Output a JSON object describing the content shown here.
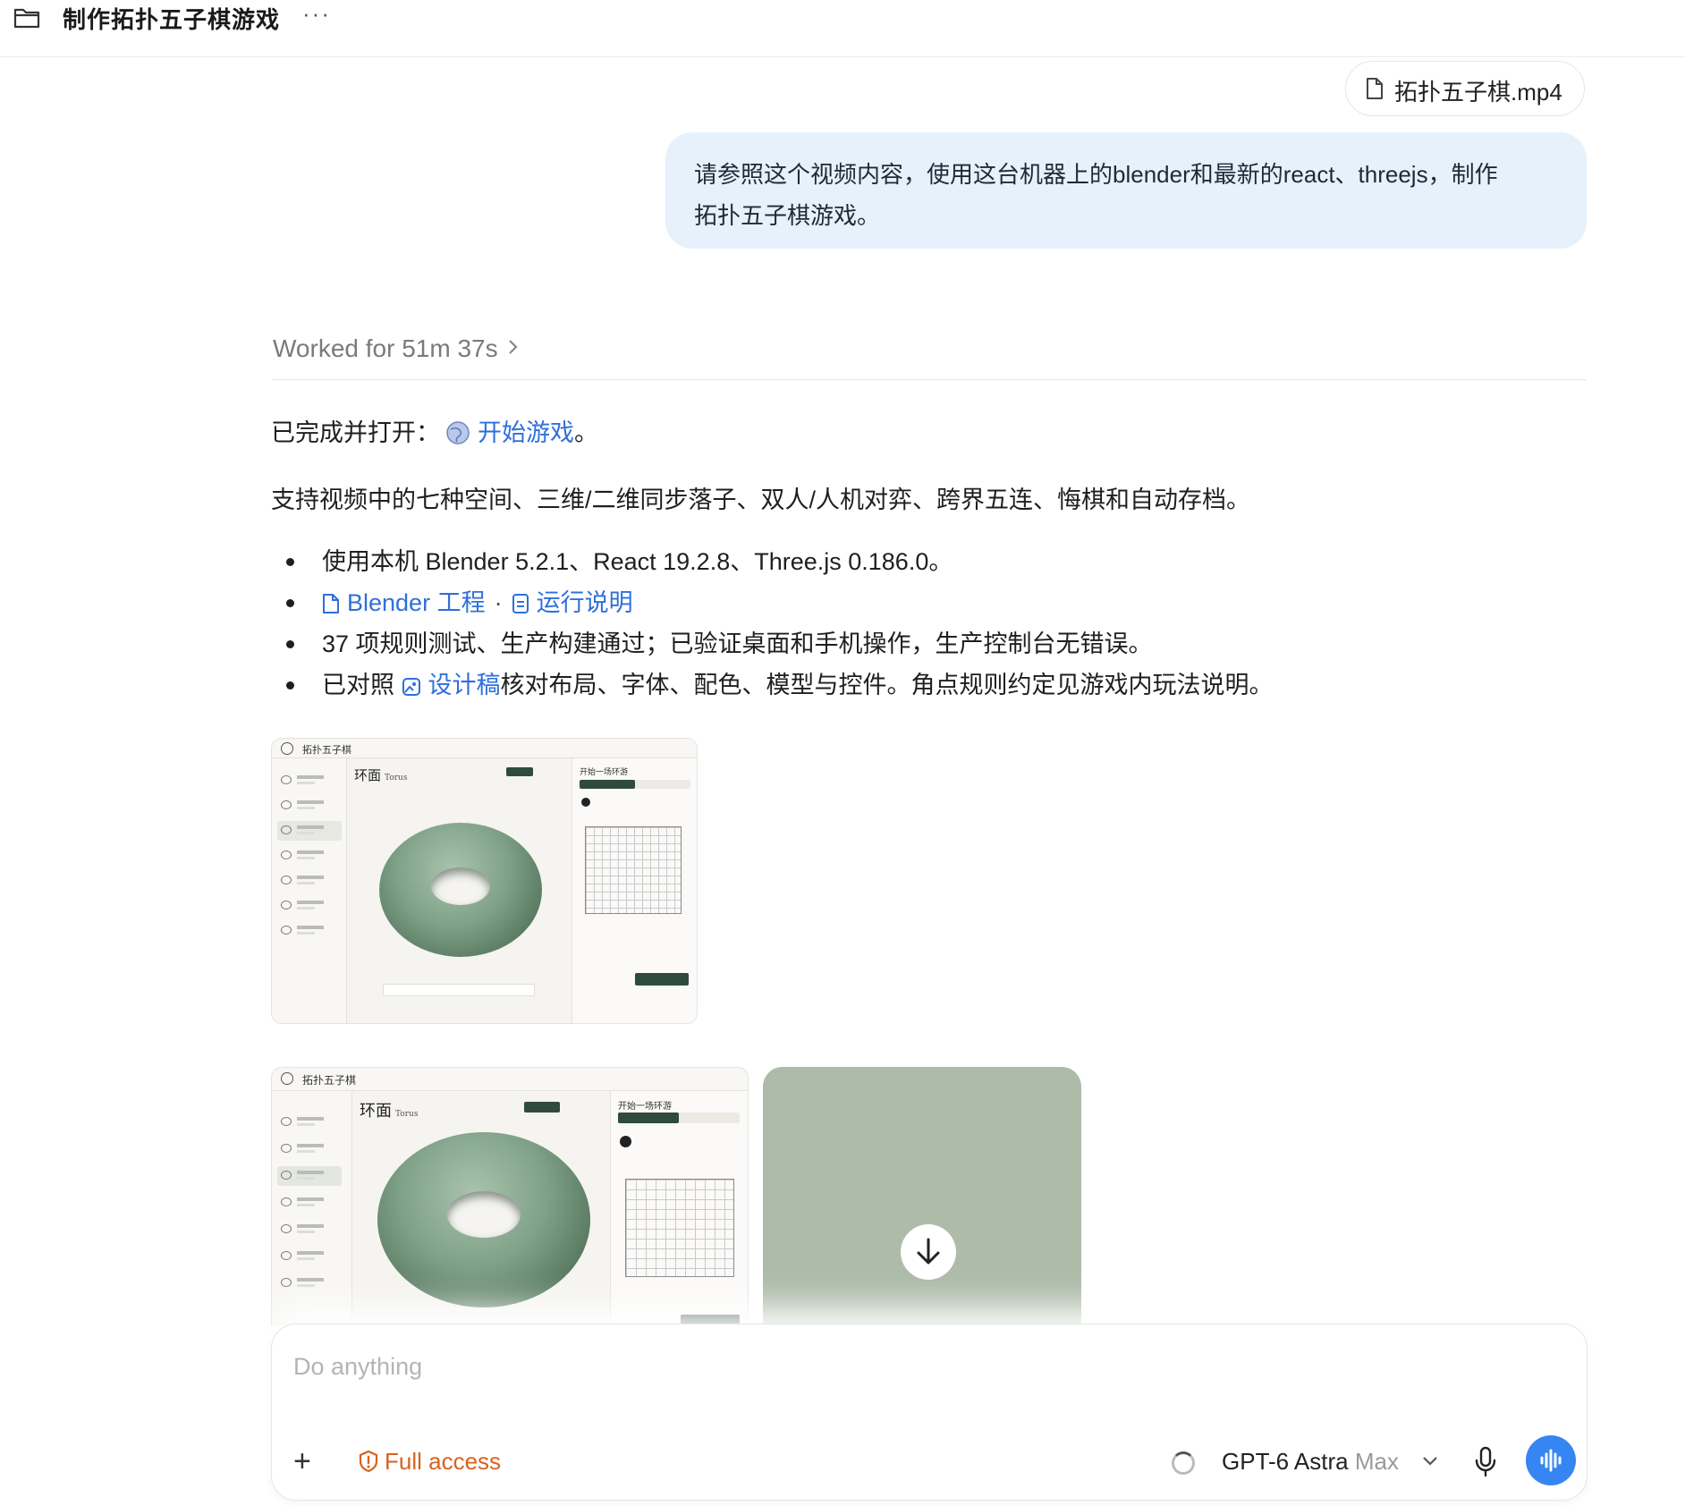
{
  "header": {
    "title": "制作拓扑五子棋游戏",
    "more_label": "···"
  },
  "attachment": {
    "filename": "拓扑五子棋.mp4"
  },
  "user_message": {
    "line1": "请参照这个视频内容，使用这台机器上的blender和最新的react、threejs，制作",
    "line2": "拓扑五子棋游戏。"
  },
  "worked": {
    "label": "Worked for 51m 37s"
  },
  "reply": {
    "done_prefix": "已完成并打开：",
    "done_link": "开始游戏",
    "done_suffix": "。",
    "summary": "支持视频中的七种空间、三维/二维同步落子、双人/人机对弈、跨界五连、悔棋和自动存档。",
    "bullets": {
      "b1": "使用本机 Blender 5.2.1、React 19.2.8、Three.js 0.186.0。",
      "b2_link1": "Blender 工程",
      "b2_sep": "·",
      "b2_link2": "运行说明",
      "b3": "37 项规则测试、生产构建通过；已验证桌面和手机操作，生产控制台无错误。",
      "b4_prefix": "已对照",
      "b4_link": "设计稿",
      "b4_suffix": "核对布局、字体、配色、模型与控件。角点规则约定见游戏内玩法说明。"
    }
  },
  "thumbnails": {
    "app_title": "拓扑五子棋",
    "heading": "环面",
    "heading_en": "Torus",
    "panel_title": "开始一场环游"
  },
  "composer": {
    "placeholder": "Do anything",
    "plus_label": "+",
    "access_label": "Full access",
    "model_name": "GPT-6 Astra",
    "model_variant": "Max"
  },
  "colors": {
    "accent": "#3585f3",
    "link": "#2f6fdc",
    "warning": "#d9621e",
    "bubble": "#e6f1fc",
    "board_green": "#2f4a3e"
  }
}
